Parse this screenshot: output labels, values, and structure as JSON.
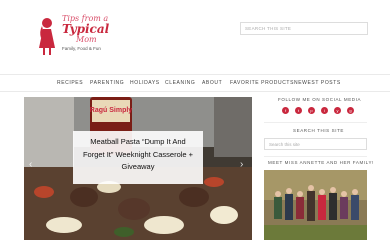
{
  "header": {
    "logo": {
      "line1": "Tips from a",
      "line2": "Typical",
      "line3": "Mom",
      "tagline": "Family, Food & Fun"
    },
    "search_placeholder": "SEARCH THIS SITE"
  },
  "nav": {
    "items": [
      "RECIPES",
      "PARENTING",
      "HOLIDAYS",
      "CLEANING",
      "ABOUT",
      "FAVORITE PRODUCTS",
      "NEWEST POSTS"
    ]
  },
  "hero": {
    "caption": "Meatball Pasta “Dump It And Forget It” Weeknight Casserole + Giveaway",
    "jar_label": "Ragú Simply",
    "prev_arrow": "‹",
    "next_arrow": "›"
  },
  "sidebar": {
    "social_title": "FOLLOW ME ON SOCIAL MEDIA",
    "social_icons": [
      "f",
      "t",
      "p",
      "i",
      "y",
      "g"
    ],
    "search_title": "SEARCH THIS SITE",
    "search_placeholder": "Search this site",
    "family_title": "MEET MISS ANNETTE AND HER FAMILY!"
  },
  "colors": {
    "brand": "#c9283e",
    "nav_text": "#444444"
  }
}
